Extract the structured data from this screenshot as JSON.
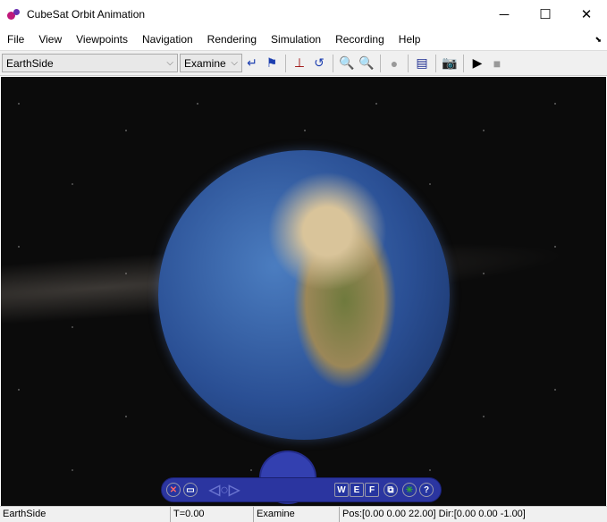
{
  "window": {
    "title": "CubeSat Orbit Animation",
    "minimize": "─",
    "maximize": "☐",
    "close": "✕"
  },
  "menu": [
    "File",
    "View",
    "Viewpoints",
    "Navigation",
    "Rendering",
    "Simulation",
    "Recording",
    "Help"
  ],
  "toolbar": {
    "viewpoint": "EarthSide",
    "nav_mode": "Examine"
  },
  "navpanel": {
    "w": "W",
    "e": "E",
    "f": "F",
    "help": "?"
  },
  "status": {
    "viewpoint": "EarthSide",
    "time": "T=0.00",
    "mode": "Examine",
    "posdir": "Pos:[0.00 0.00 22.00] Dir:[0.00 0.00 -1.00]"
  }
}
